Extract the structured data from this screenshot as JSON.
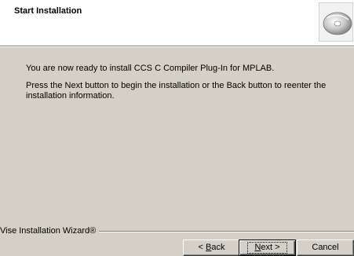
{
  "header": {
    "title": "Start Installation",
    "icon": "cd-disc-icon"
  },
  "content": {
    "line1": "You are now ready to install CCS C Compiler Plug-In for MPLAB.",
    "line2": "Press the Next button to begin the installation or the Back button to reenter the installation information."
  },
  "footer": {
    "brand": "Vise Installation Wizard®"
  },
  "buttons": {
    "back_prefix": "< ",
    "back_mnemonic": "B",
    "back_rest": "ack",
    "next_mnemonic": "N",
    "next_rest": "ext >",
    "cancel": "Cancel"
  }
}
